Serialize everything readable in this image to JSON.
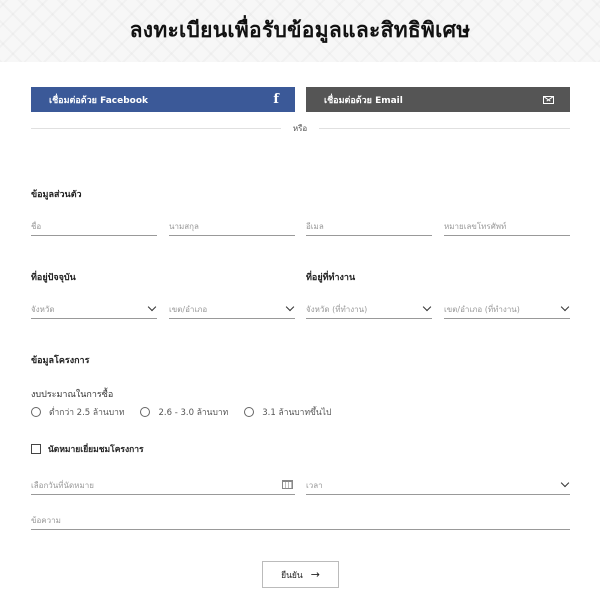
{
  "header": {
    "title": "ลงทะเบียนเพื่อรับข้อมูลและสิทธิพิเศษ"
  },
  "social": {
    "facebook_label": "เชื่อมต่อด้วย Facebook",
    "facebook_icon": "f",
    "email_label": "เชื่อมต่อด้วย Email",
    "or_text": "หรือ"
  },
  "personal": {
    "title": "ข้อมูลส่วนตัว",
    "first_name_placeholder": "ชื่อ",
    "last_name_placeholder": "นามสกุล",
    "email_placeholder": "อีเมล",
    "phone_placeholder": "หมายเลขโทรศัพท์"
  },
  "address": {
    "home_title": "ที่อยู่ปัจจุบัน",
    "work_title": "ที่อยู่ที่ทำงาน",
    "province_placeholder": "จังหวัด",
    "district_placeholder": "เขต/อำเภอ",
    "work_province_placeholder": "จังหวัด (ที่ทำงาน)",
    "work_district_placeholder": "เขต/อำเภอ (ที่ทำงาน)"
  },
  "project": {
    "title": "ข้อมูลโครงการ",
    "budget_label": "งบประมาณในการซื้อ",
    "budget_options": [
      "ต่ำกว่า 2.5 ล้านบาท",
      "2.6 - 3.0 ล้านบาท",
      "3.1 ล้านบาทขึ้นไป"
    ],
    "appointment_label": "นัดหมายเยี่ยมชมโครงการ",
    "date_placeholder": "เลือกวันที่นัดหมาย",
    "time_placeholder": "เวลา",
    "message_placeholder": "ข้อความ"
  },
  "submit": {
    "label": "ยืนยัน",
    "arrow": "→"
  }
}
